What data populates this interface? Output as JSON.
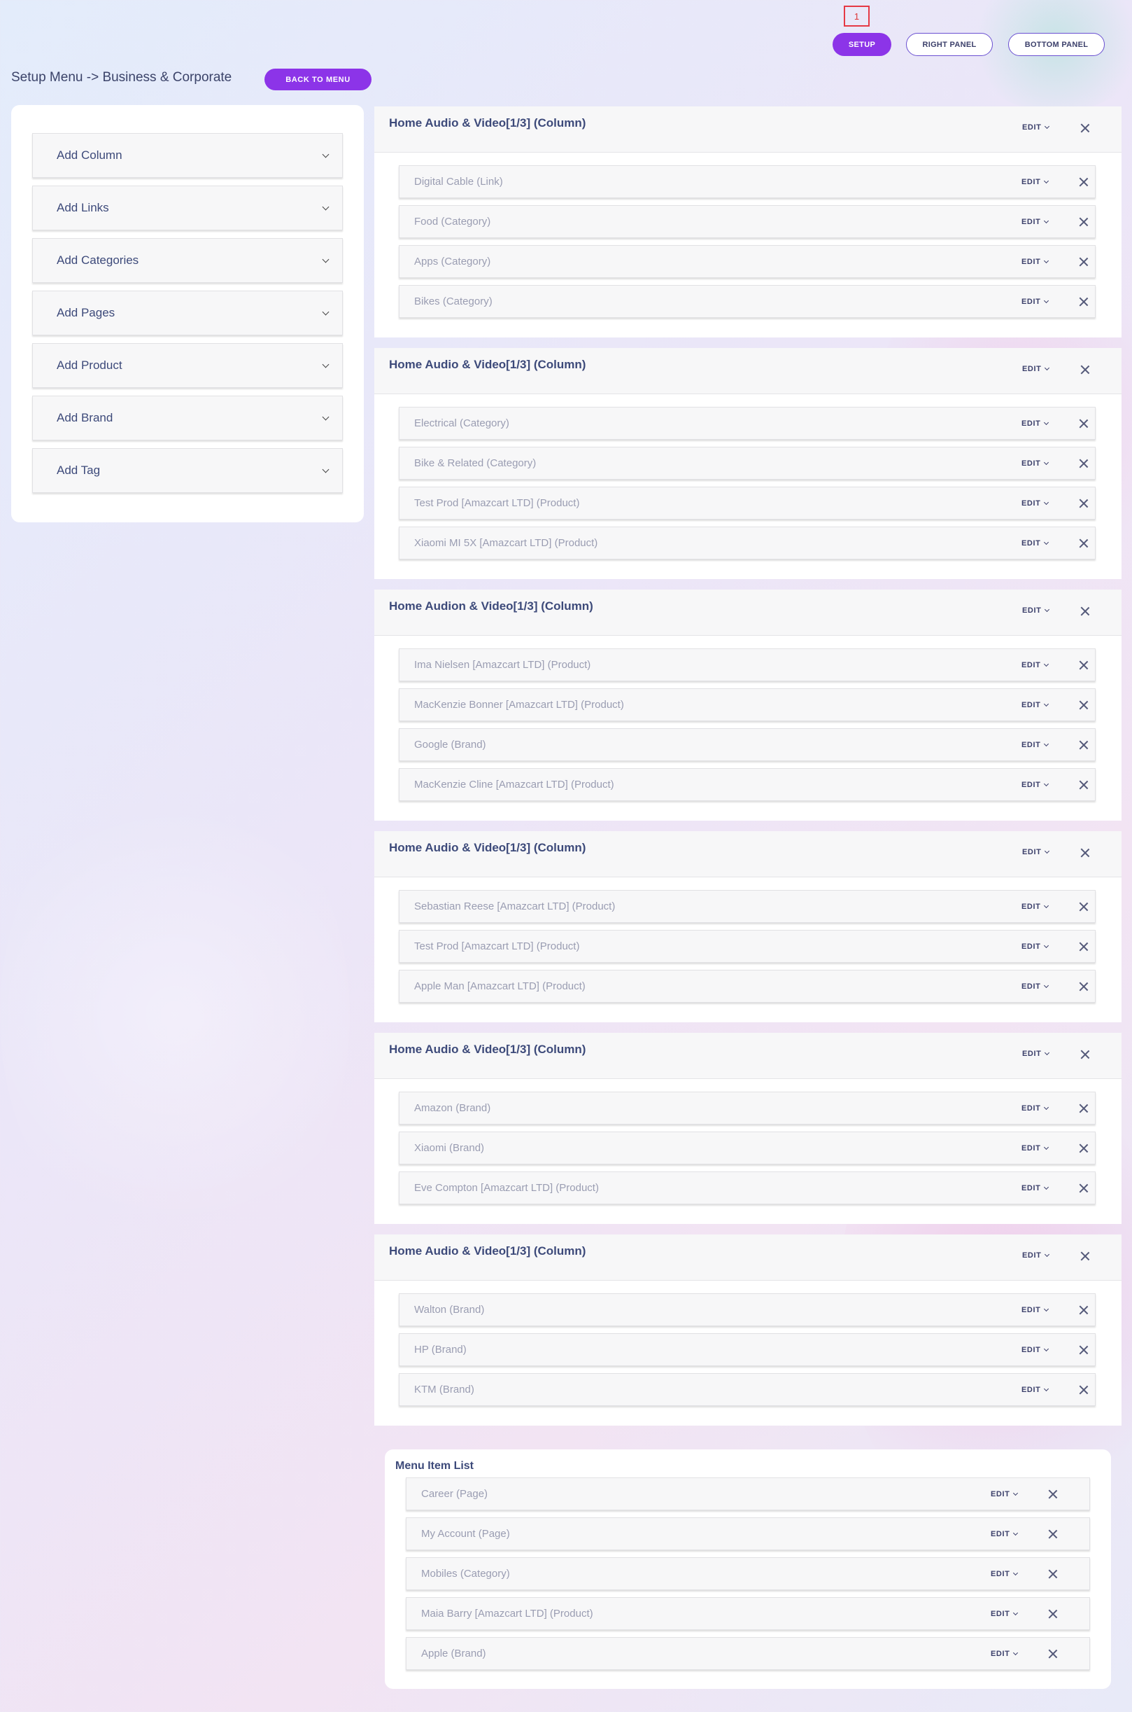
{
  "marker": "1",
  "top_nav": {
    "setup": "SETUP",
    "right_panel": "RIGHT PANEL",
    "bottom_panel": "BOTTOM PANEL"
  },
  "page_title": "Setup Menu -> Business & Corporate",
  "back_button": "BACK TO MENU",
  "sidebar": {
    "items": [
      {
        "label": "Add Column"
      },
      {
        "label": "Add Links"
      },
      {
        "label": "Add Categories"
      },
      {
        "label": "Add Pages"
      },
      {
        "label": "Add Product"
      },
      {
        "label": "Add Brand"
      },
      {
        "label": "Add Tag"
      }
    ]
  },
  "edit_label": "EDIT",
  "columns": [
    {
      "title": "Home Audio & Video[1/3] (Column)",
      "items": [
        "Digital Cable (Link)",
        "Food (Category)",
        "Apps (Category)",
        "Bikes (Category)"
      ]
    },
    {
      "title": "Home Audio & Video[1/3] (Column)",
      "items": [
        "Electrical (Category)",
        "Bike & Related (Category)",
        "Test Prod [Amazcart LTD] (Product)",
        "Xiaomi MI 5X [Amazcart LTD] (Product)"
      ]
    },
    {
      "title": "Home Audion & Video[1/3] (Column)",
      "items": [
        "Ima Nielsen [Amazcart LTD] (Product)",
        "MacKenzie Bonner [Amazcart LTD] (Product)",
        "Google (Brand)",
        "MacKenzie Cline [Amazcart LTD] (Product)"
      ]
    },
    {
      "title": "Home Audio & Video[1/3] (Column)",
      "items": [
        "Sebastian Reese [Amazcart LTD] (Product)",
        "Test Prod [Amazcart LTD] (Product)",
        "Apple Man [Amazcart LTD] (Product)"
      ]
    },
    {
      "title": "Home Audio & Video[1/3] (Column)",
      "items": [
        "Amazon (Brand)",
        "Xiaomi (Brand)",
        "Eve Compton [Amazcart LTD] (Product)"
      ]
    },
    {
      "title": "Home Audio & Video[1/3] (Column)",
      "items": [
        "Walton (Brand)",
        "HP (Brand)",
        "KTM (Brand)"
      ]
    }
  ],
  "menu_item_list": {
    "title": "Menu Item List",
    "items": [
      "Career (Page)",
      "My Account (Page)",
      "Mobiles (Category)",
      "Maia Barry [Amazcart LTD] (Product)",
      "Apple (Brand)"
    ]
  },
  "colors": {
    "accent": "#8c34e8",
    "heading": "#3d4a7a",
    "item_text": "#9a9db2"
  }
}
